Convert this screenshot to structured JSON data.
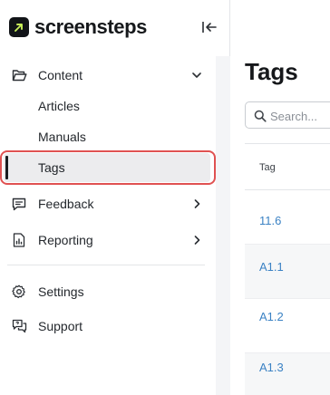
{
  "app": {
    "logo_text": "screensteps"
  },
  "sidebar": {
    "content": {
      "label": "Content"
    },
    "sub_items": [
      {
        "label": "Articles"
      },
      {
        "label": "Manuals"
      },
      {
        "label": "Tags"
      }
    ],
    "feedback": {
      "label": "Feedback"
    },
    "reporting": {
      "label": "Reporting"
    },
    "settings": {
      "label": "Settings"
    },
    "support": {
      "label": "Support"
    }
  },
  "main": {
    "title": "Tags",
    "search_placeholder": "Search...",
    "table": {
      "column": "Tag",
      "rows": [
        "11.6",
        "A1.1",
        "A1.2",
        "A1.3"
      ]
    }
  },
  "colors": {
    "accent_link": "#3b82c4",
    "highlight_border": "#e05252",
    "active_bg": "#ececee"
  }
}
